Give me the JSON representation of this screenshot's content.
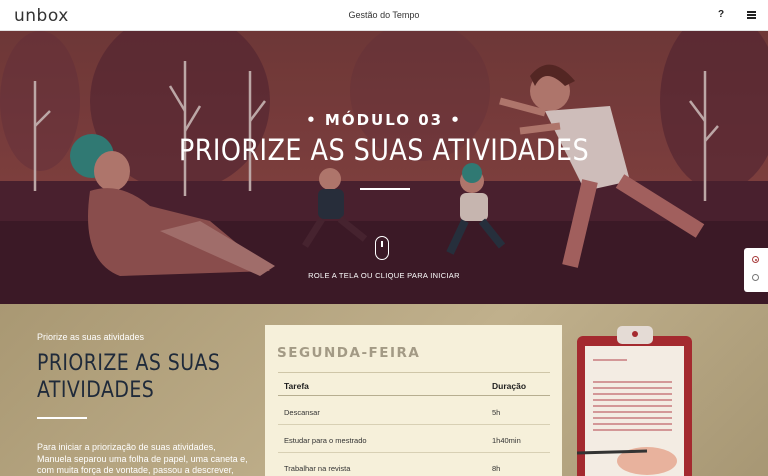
{
  "header": {
    "logo": "unbox",
    "title": "Gestão do Tempo",
    "help_label": "?"
  },
  "hero": {
    "module_label": "• MÓDULO 03 •",
    "title": "PRIORIZE AS SUAS ATIVIDADES",
    "scroll_hint": "ROLE A TELA OU CLIQUE PARA INICIAR"
  },
  "section": {
    "eyebrow": "Priorize as suas atividades",
    "title": "PRIORIZE AS SUAS ATIVIDADES",
    "body": "Para iniciar a priorização de suas atividades, Manuela separou uma folha de papel, uma caneta e, com muita força de vontade, passou a descrever, diariamente e"
  },
  "schedule": {
    "day": "SEGUNDA-FEIRA",
    "headers": [
      "Tarefa",
      "Duração"
    ],
    "rows": [
      [
        "Descansar",
        "5h"
      ],
      [
        "Estudar para o mestrado",
        "1h40min"
      ],
      [
        "Trabalhar na revista",
        "8h"
      ]
    ]
  },
  "colors": {
    "hero_background": "#8b4744",
    "section_background": "#b9a883",
    "card_background": "#f6f0da",
    "clipboard": "#a42a2f",
    "accent_active": "#a83d3d"
  },
  "icons": [
    "help-icon",
    "menu-icon",
    "mouse-scroll-icon"
  ]
}
